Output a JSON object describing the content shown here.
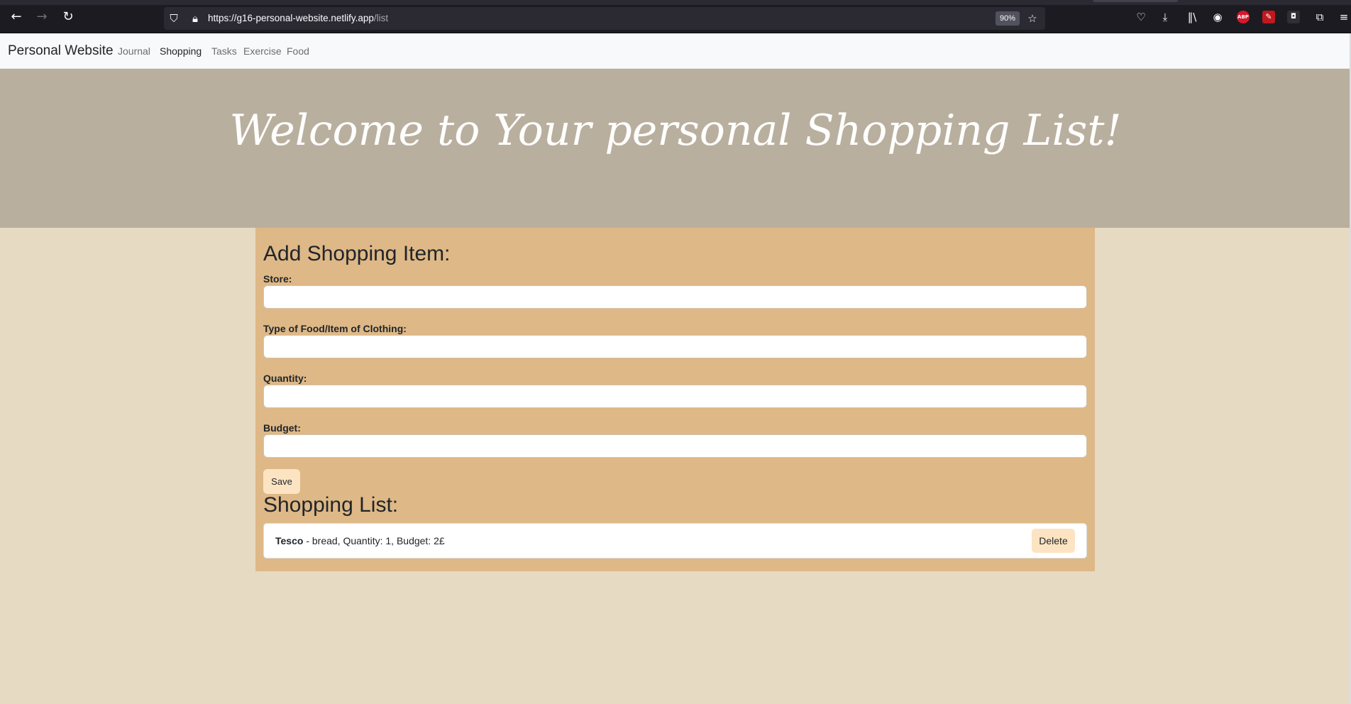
{
  "browser": {
    "url_host": "https://g16-personal-website.netlify.app",
    "url_path": "/list",
    "zoom": "90%",
    "icons": {
      "back": "arrow-left-icon",
      "forward": "arrow-right-icon",
      "reload": "reload-icon",
      "shield": "shield-icon",
      "lock": "lock-icon",
      "bookmark": "star-icon",
      "pocket": "pocket-icon",
      "downloads": "download-icon",
      "library": "library-icon",
      "account": "account-icon",
      "abp": "adblock-icon",
      "ext_red": "extension-red-icon",
      "ext_dark": "extension-dark-icon",
      "extensions": "puzzle-icon",
      "menu": "hamburger-menu-icon"
    },
    "abp_label": "ABP"
  },
  "navbar": {
    "brand": "Personal Website",
    "links": [
      "Journal",
      "Shopping",
      "Tasks",
      "Exercise",
      "Food"
    ],
    "active": "Shopping"
  },
  "hero": {
    "title": "Welcome to Your personal Shopping List!"
  },
  "form": {
    "title": "Add Shopping Item:",
    "fields": [
      {
        "label": "Store:",
        "value": ""
      },
      {
        "label": "Type of Food/Item of Clothing:",
        "value": ""
      },
      {
        "label": "Quantity:",
        "value": ""
      },
      {
        "label": "Budget:",
        "value": ""
      }
    ],
    "save_label": "Save"
  },
  "list": {
    "title": "Shopping List:",
    "items": [
      {
        "store": "Tesco",
        "details": " - bread, Quantity: 1, Budget: 2£",
        "delete_label": "Delete"
      }
    ]
  },
  "colors": {
    "hero_bg": "#b9af9e",
    "page_bg": "#e6dac3",
    "panel_bg": "#deb887",
    "button_bg": "#fce4c3"
  }
}
